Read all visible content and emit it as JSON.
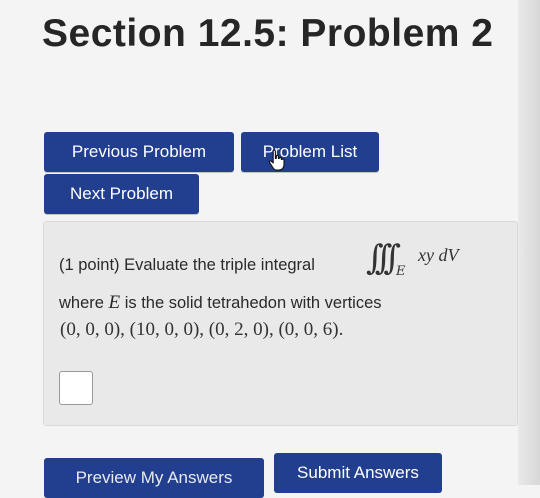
{
  "header": {
    "title": "Section 12.5: Problem 2"
  },
  "nav": {
    "previous_label": "Previous Problem",
    "list_label": "Problem List",
    "next_label": "Next Problem"
  },
  "problem": {
    "points": "(1 point) Evaluate the triple integral",
    "integral_signs": "∫∫∫",
    "integral_region": "E",
    "integrand": "xy dV",
    "where_prefix": "where ",
    "region_symbol": "E",
    "where_suffix": " is the solid tetrahedon with vertices",
    "vertices": "(0, 0, 0), (10, 0, 0), (0, 2, 0), (0, 0, 6)."
  },
  "answer": {
    "value": ""
  },
  "actions": {
    "preview_label": "Preview My Answers",
    "submit_label": "Submit Answers"
  },
  "colors": {
    "button_bg": "#213e8f",
    "panel_bg": "#e8e9e8"
  }
}
